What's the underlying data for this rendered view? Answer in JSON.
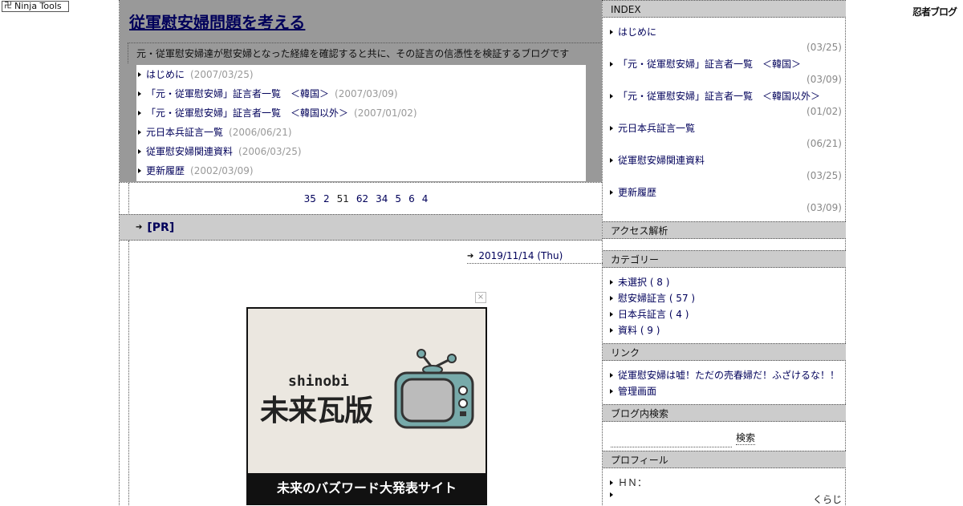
{
  "toolbar": {
    "ninja_tools": "Ninja Tools",
    "brand_logo": "忍者ブログ"
  },
  "blog": {
    "title": "従軍慰安婦問題を考える",
    "description": "元・従軍慰安婦達が慰安婦となった経緯を確認すると共に、その証言の信憑性を検証するブログです"
  },
  "recent_entries": [
    {
      "title": "はじめに",
      "date": "(2007/03/25)"
    },
    {
      "title": "「元・従軍慰安婦」証言者一覧　＜韓国＞",
      "date": "(2007/03/09)"
    },
    {
      "title": "「元・従軍慰安婦」証言者一覧　＜韓国以外＞",
      "date": "(2007/01/02)"
    },
    {
      "title": "元日本兵証言一覧",
      "date": "(2006/06/21)"
    },
    {
      "title": "従軍慰安婦関連資料",
      "date": "(2006/03/25)"
    },
    {
      "title": "更新履歴",
      "date": "(2002/03/09)"
    }
  ],
  "pager": {
    "links": [
      "35",
      "2"
    ],
    "current": "51",
    "links_after": [
      "62",
      "34",
      "5",
      "6",
      "4"
    ]
  },
  "pr": {
    "label": "[PR]"
  },
  "entry": {
    "date": "2019/11/14 (Thu)"
  },
  "ad": {
    "close": "×",
    "brand": "shinobi",
    "title": "未来瓦版",
    "tagline": "未来のバズワード大発表サイト"
  },
  "sidebar": {
    "index": {
      "heading": "INDEX",
      "items": [
        {
          "title": "はじめに",
          "date": "(03/25)"
        },
        {
          "title": "「元・従軍慰安婦」証言者一覧　＜韓国＞",
          "date": "(03/09)"
        },
        {
          "title": "「元・従軍慰安婦」証言者一覧　＜韓国以外＞",
          "date": "(01/02)"
        },
        {
          "title": "元日本兵証言一覧",
          "date": "(06/21)"
        },
        {
          "title": "従軍慰安婦関連資料",
          "date": "(03/25)"
        },
        {
          "title": "更新履歴",
          "date": "(03/09)"
        }
      ]
    },
    "access": {
      "heading": "アクセス解析"
    },
    "categories": {
      "heading": "カテゴリー",
      "items": [
        "未選択 ( 8 )",
        "慰安婦証言 ( 57 )",
        "日本兵証言 ( 4 )",
        "資料 ( 9 )"
      ]
    },
    "links": {
      "heading": "リンク",
      "items": [
        "従軍慰安婦は嘘！ただの売春婦だ！ふざけるな！！",
        "管理画面"
      ]
    },
    "search": {
      "heading": "ブログ内検索",
      "button": "検索",
      "value": ""
    },
    "profile": {
      "heading": "プロフィール",
      "hn_label": "ＨＮ：",
      "hn_value": "くらじ"
    }
  }
}
